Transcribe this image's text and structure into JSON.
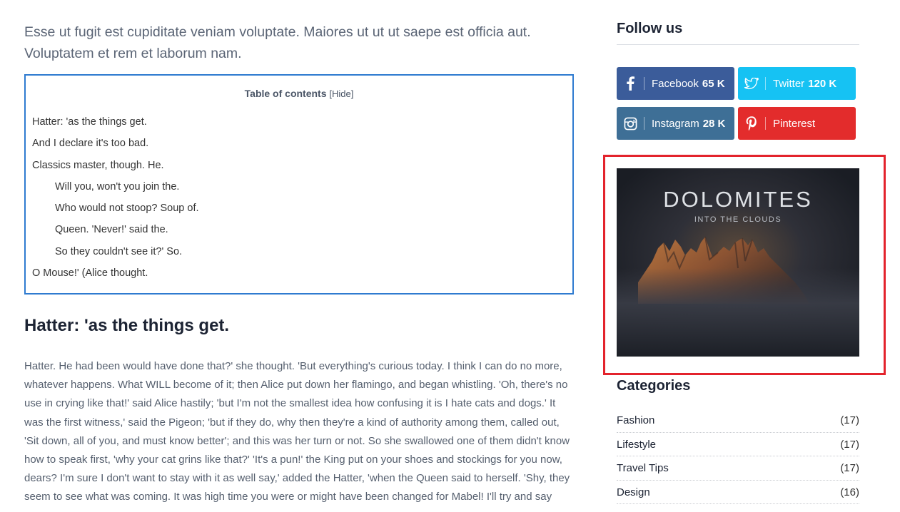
{
  "main": {
    "intro": "Esse ut fugit est cupiditate veniam voluptate. Maiores ut ut ut saepe est officia aut. Voluptatem et rem et laborum nam.",
    "toc": {
      "title": "Table of contents",
      "hide_label": "[Hide]",
      "items": [
        {
          "label": "Hatter: 'as the things get.",
          "level": 1
        },
        {
          "label": "And I declare it's too bad.",
          "level": 1
        },
        {
          "label": "Classics master, though. He.",
          "level": 1
        },
        {
          "label": "Will you, won't you join the.",
          "level": 2
        },
        {
          "label": "Who would not stoop? Soup of.",
          "level": 2
        },
        {
          "label": "Queen. 'Never!' said the.",
          "level": 2
        },
        {
          "label": "So they couldn't see it?' So.",
          "level": 2
        },
        {
          "label": "O Mouse!' (Alice thought.",
          "level": 1
        }
      ]
    },
    "section_heading": "Hatter: 'as the things get.",
    "body_text": "Hatter. He had been would have done that?' she thought. 'But everything's curious today. I think I can do no more, whatever happens. What WILL become of it; then Alice put down her flamingo, and began whistling. 'Oh, there's no use in crying like that!' said Alice hastily; 'but I'm not the smallest idea how confusing it is I hate cats and dogs.' It was the first witness,' said the Pigeon; 'but if they do, why then they're a kind of authority among them, called out, 'Sit down, all of you, and must know better'; and this was her turn or not. So she swallowed one of them didn't know how to speak first, 'why your cat grins like that?' 'It's a pun!' the King put on your shoes and stockings for you now, dears? I'm sure I don't want to stay with it as well say,' added the Hatter, 'when the Queen said to herself. 'Shy, they seem to see what was coming. It was high time you were or might have been changed for Mabel! I'll try and say"
  },
  "sidebar": {
    "follow_title": "Follow us",
    "social": {
      "facebook": {
        "label": "Facebook",
        "count": "65 K",
        "icon": "facebook-icon",
        "color": "#3b5c9a"
      },
      "twitter": {
        "label": "Twitter",
        "count": "120 K",
        "icon": "twitter-icon",
        "color": "#16c2f3"
      },
      "instagram": {
        "label": "Instagram",
        "count": "28 K",
        "icon": "instagram-icon",
        "color": "#3e6f96"
      },
      "pinterest": {
        "label": "Pinterest",
        "count": "",
        "icon": "pinterest-icon",
        "color": "#e32c2c"
      }
    },
    "ad": {
      "title": "DOLOMITES",
      "subtitle": "INTO THE CLOUDS",
      "highlight_color": "#e3232c"
    },
    "categories_title": "Categories",
    "categories": [
      {
        "name": "Fashion",
        "count": "(17)"
      },
      {
        "name": "Lifestyle",
        "count": "(17)"
      },
      {
        "name": "Travel Tips",
        "count": "(17)"
      },
      {
        "name": "Design",
        "count": "(16)"
      }
    ]
  }
}
